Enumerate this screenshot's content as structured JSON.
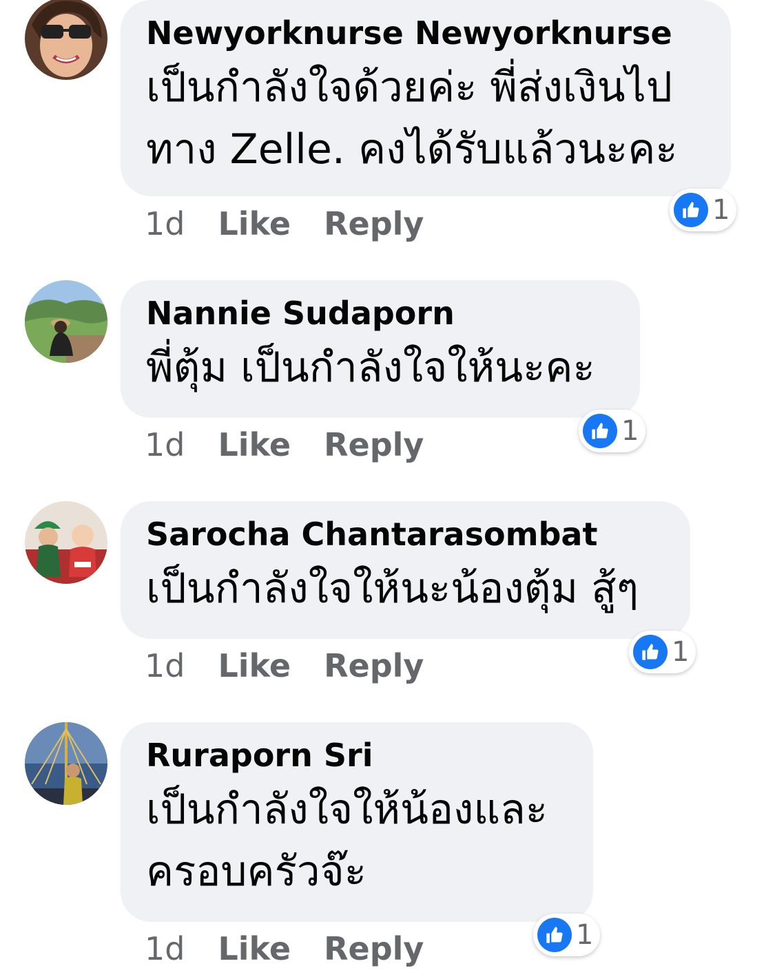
{
  "comments": [
    {
      "author": "Newyorknurse Newyorknurse",
      "text": "เป็นกำลังใจด้วยค่ะ  พี่ส่งเงินไป\nทาง Zelle. คงได้รับแล้วนะคะ",
      "time": "1d",
      "like_label": "Like",
      "reply_label": "Reply",
      "reactions": "1"
    },
    {
      "author": "Nannie Sudaporn",
      "text": "พี่ตุ้ม เป็นกำลังใจให้นะคะ",
      "time": "1d",
      "like_label": "Like",
      "reply_label": "Reply",
      "reactions": "1"
    },
    {
      "author": "Sarocha Chantarasombat",
      "text": "เป็นกำลังใจให้นะน้องตุ้ม สู้ๆ",
      "time": "1d",
      "like_label": "Like",
      "reply_label": "Reply",
      "reactions": "1"
    },
    {
      "author": "Ruraporn Sri",
      "text": "เป็นกำลังใจให้น้องและ\nครอบครัวจ๊ะ",
      "time": "1d",
      "like_label": "Like",
      "reply_label": "Reply",
      "reactions": "1"
    }
  ],
  "colors": {
    "bubble": "#f0f1f5",
    "text": "#050505",
    "secondary": "#65676b",
    "like_blue": "#1877f2"
  }
}
